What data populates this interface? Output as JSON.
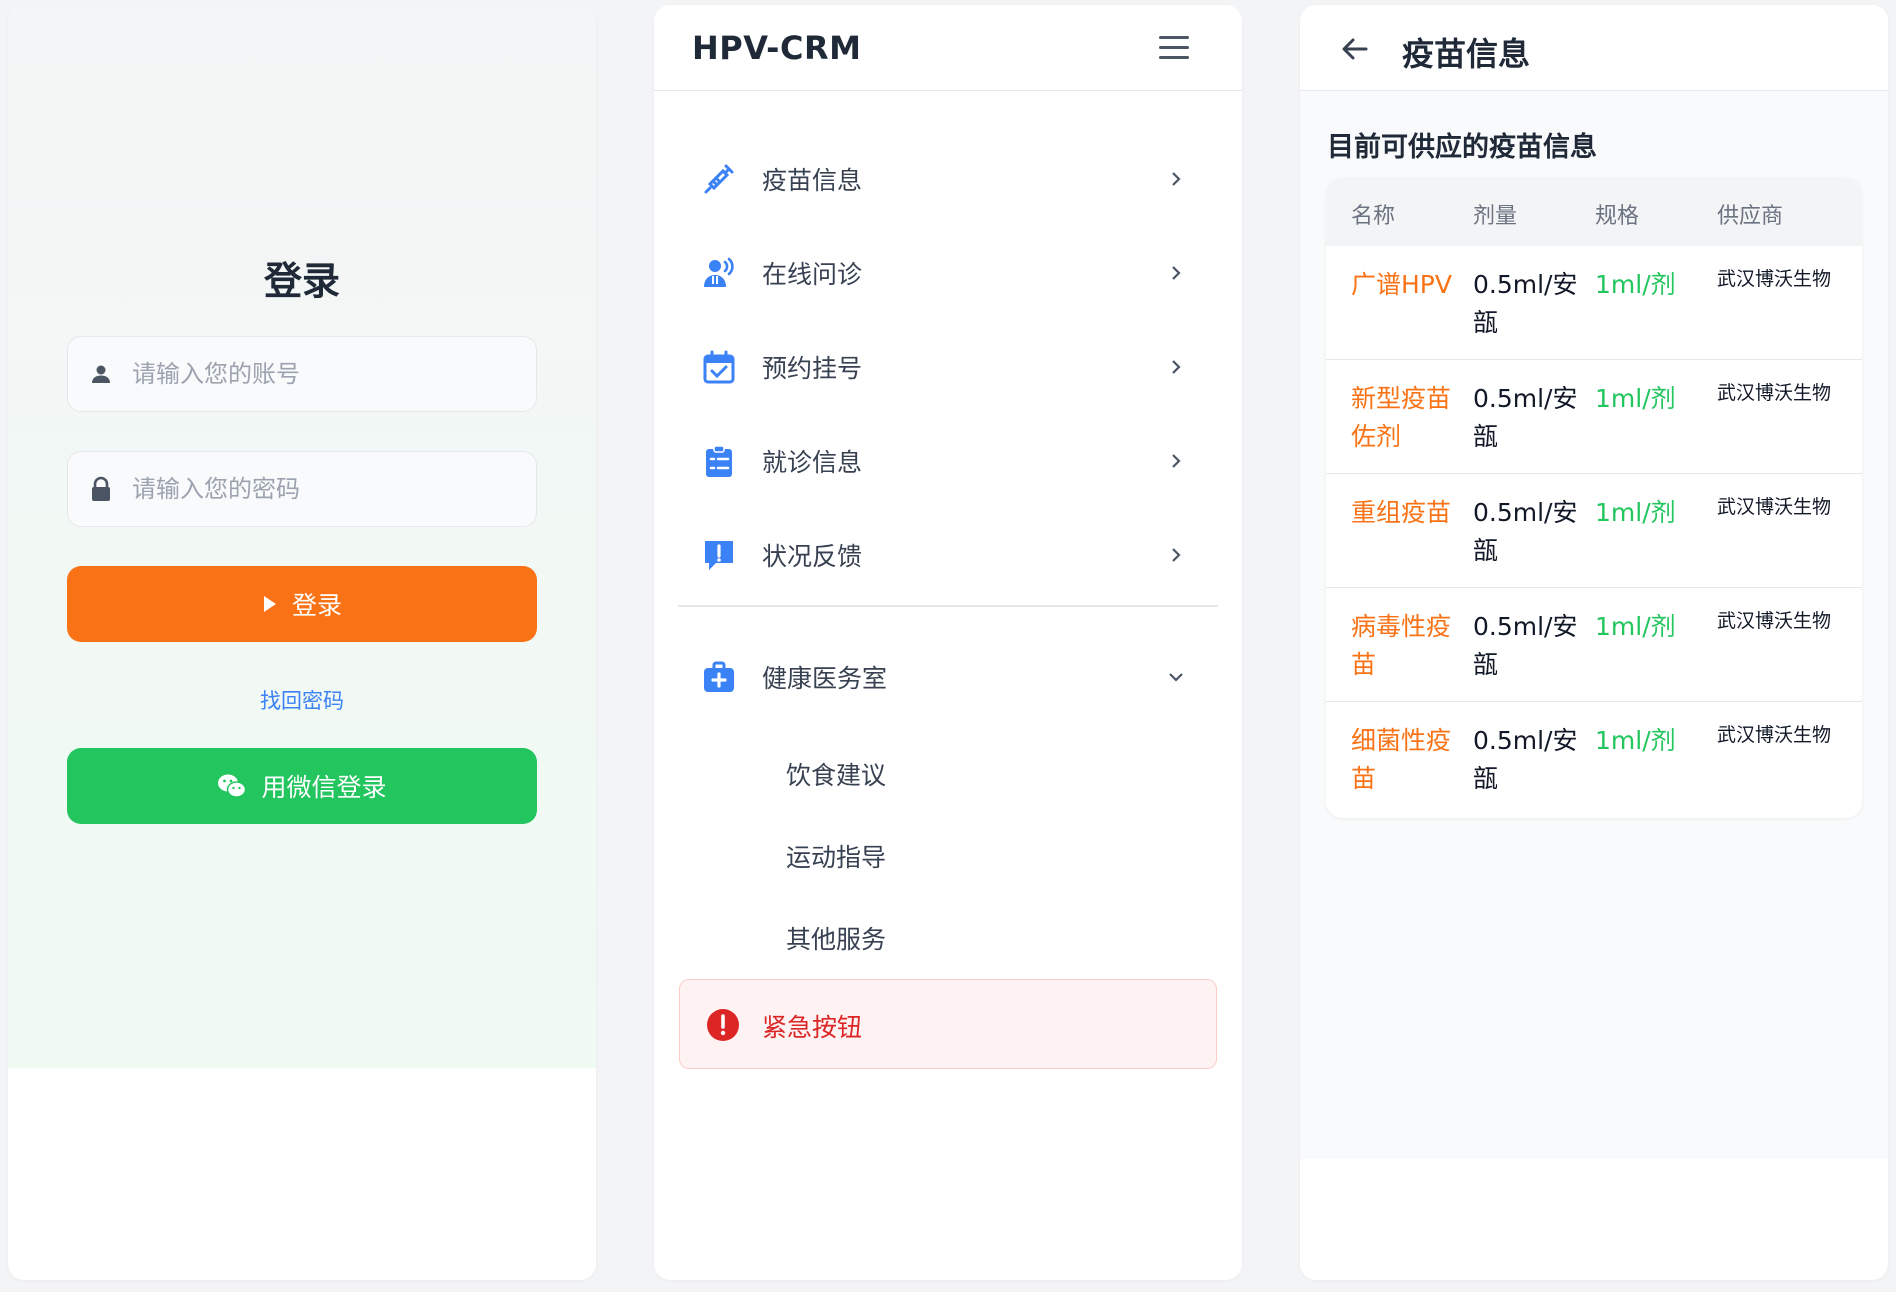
{
  "login": {
    "title": "登录",
    "account_placeholder": "请输入您的账号",
    "password_placeholder": "请输入您的密码",
    "login_button": "登录",
    "forgot_password": "找回密码",
    "wechat_button": "用微信登录",
    "colors": {
      "login_button": "#f97316",
      "wechat_button": "#22c55e",
      "link": "#3b82f6"
    }
  },
  "menu": {
    "app_title": "HPV-CRM",
    "items": [
      {
        "label": "疫苗信息",
        "icon": "syringe-icon"
      },
      {
        "label": "在线问诊",
        "icon": "doctor-consult-icon"
      },
      {
        "label": "预约挂号",
        "icon": "calendar-check-icon"
      },
      {
        "label": "就诊信息",
        "icon": "clipboard-list-icon"
      },
      {
        "label": "状况反馈",
        "icon": "feedback-icon"
      }
    ],
    "health_room": {
      "label": "健康医务室",
      "icon": "medical-kit-icon",
      "subitems": [
        "饮食建议",
        "运动指导",
        "其他服务"
      ]
    },
    "emergency": {
      "label": "紧急按钮",
      "icon": "alert-circle-icon"
    },
    "colors": {
      "icon": "#3b82f6",
      "emergency": "#dc2626"
    }
  },
  "vaccine": {
    "page_title": "疫苗信息",
    "subtitle": "目前可供应的疫苗信息",
    "columns": [
      "名称",
      "剂量",
      "规格",
      "供应商"
    ],
    "rows": [
      {
        "name": "广谱HPV",
        "dose": "0.5ml/安瓿",
        "spec": "1ml/剂",
        "supplier": "武汉博沃生物"
      },
      {
        "name": "新型疫苗佐剂",
        "dose": "0.5ml/安瓿",
        "spec": "1ml/剂",
        "supplier": "武汉博沃生物"
      },
      {
        "name": "重组疫苗",
        "dose": "0.5ml/安瓿",
        "spec": "1ml/剂",
        "supplier": "武汉博沃生物"
      },
      {
        "name": "病毒性疫苗",
        "dose": "0.5ml/安瓿",
        "spec": "1ml/剂",
        "supplier": "武汉博沃生物"
      },
      {
        "name": "细菌性疫苗",
        "dose": "0.5ml/安瓿",
        "spec": "1ml/剂",
        "supplier": "武汉博沃生物"
      }
    ],
    "colors": {
      "name": "#f97316",
      "spec": "#22c55e"
    }
  }
}
